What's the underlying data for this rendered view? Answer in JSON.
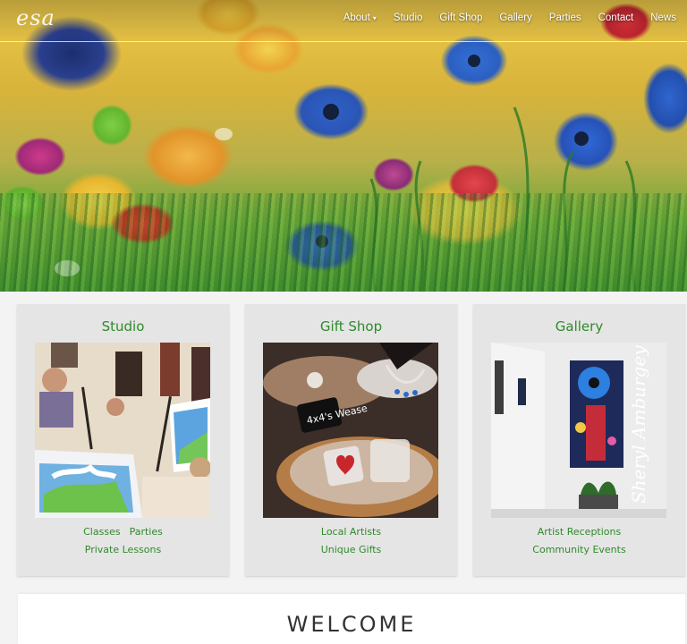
{
  "header": {
    "logo_text": "esa",
    "nav": [
      {
        "label": "About"
      },
      {
        "label": "Studio"
      },
      {
        "label": "Gift Shop"
      },
      {
        "label": "Gallery"
      },
      {
        "label": "Parties"
      },
      {
        "label": "Contact"
      },
      {
        "label": "News"
      }
    ],
    "caret_icon": "chevron-down-icon"
  },
  "cards": [
    {
      "title": "Studio",
      "line1": [
        "Classes",
        "Parties"
      ],
      "line2": [
        "Private Lessons"
      ]
    },
    {
      "title": "Gift Shop",
      "line1": [
        "Local Artists"
      ],
      "line2": [
        "Unique Gifts"
      ]
    },
    {
      "title": "Gallery",
      "line1": [
        "Artist Receptions"
      ],
      "line2": [
        "Community Events"
      ]
    }
  ],
  "gift_sign": "4x4's Wease",
  "gallery_signature": "Sheryl Amburgey",
  "welcome": {
    "heading": "WELCOME"
  },
  "colors": {
    "accent_green": "#2f8a2b",
    "card_bg": "#e5e5e5",
    "page_bg": "#f3f3f3"
  }
}
